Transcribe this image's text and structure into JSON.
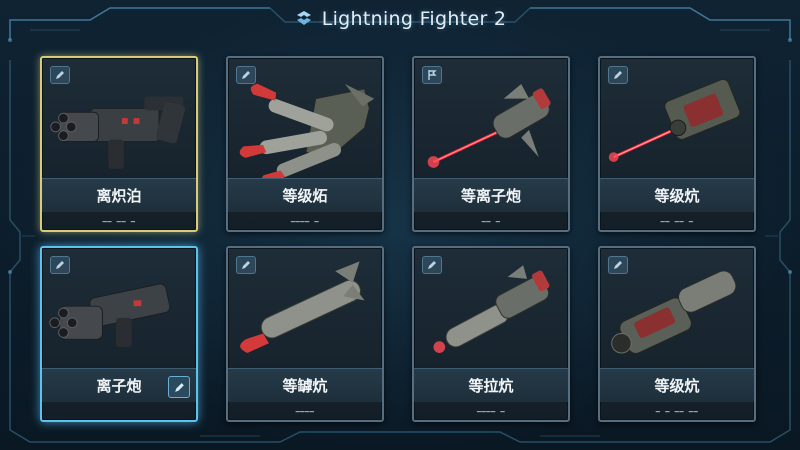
{
  "header": {
    "title": "Lightning Fighter 2"
  },
  "colors": {
    "accent": "#5cc2ee",
    "gold_select": "#d8cc7a",
    "laser": "#ff2a3a",
    "card_border": "#566e80"
  },
  "weapons": [
    {
      "label": "离炽泊",
      "sub": "━━ ━━ ━",
      "badge_icon": "pencil-icon",
      "weapon": "minigun"
    },
    {
      "label": "等级炻",
      "sub": "━━━━ ━",
      "badge_icon": "pencil-icon",
      "weapon": "missile-rack"
    },
    {
      "label": "等离子炮",
      "sub": "━━ ━",
      "badge_icon": "flag-icon",
      "weapon": "laser-pod"
    },
    {
      "label": "等级炕",
      "sub": "━━ ━━ ━",
      "badge_icon": "pencil-icon",
      "weapon": "laser-cannon"
    },
    {
      "label": "离子炮",
      "sub": "",
      "badge_icon": "pencil-icon",
      "weapon": "minigun-2",
      "edit_icon": "pencil-icon"
    },
    {
      "label": "等罅炕",
      "sub": "━━━━",
      "badge_icon": "pencil-icon",
      "weapon": "missile"
    },
    {
      "label": "等拉炕",
      "sub": "━━━━ ━",
      "badge_icon": "pencil-icon",
      "weapon": "laser-pod-2"
    },
    {
      "label": "等级炕",
      "sub": "━ ━ ━━ ━━",
      "badge_icon": "pencil-icon",
      "weapon": "rail-cannon"
    }
  ]
}
